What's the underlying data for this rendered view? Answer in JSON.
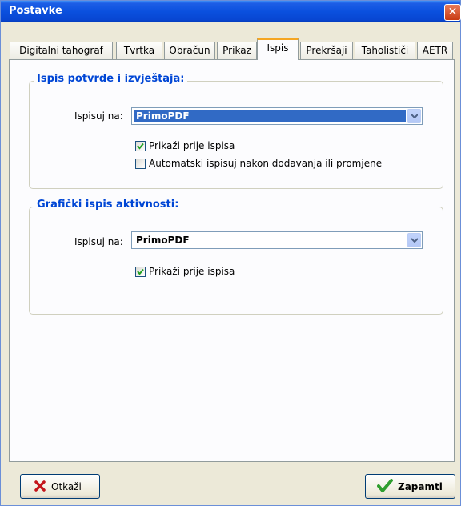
{
  "window": {
    "title": "Postavke",
    "close_glyph": "✕"
  },
  "tabs": [
    {
      "label": "Digitalni tahograf"
    },
    {
      "label": "Tvrtka"
    },
    {
      "label": "Obračun"
    },
    {
      "label": "Prikaz"
    },
    {
      "label": "Ispis"
    },
    {
      "label": "Prekršaji"
    },
    {
      "label": "Taholističi"
    },
    {
      "label": "AETR"
    }
  ],
  "active_tab": "Ispis",
  "group1": {
    "title": "Ispis potvrde i izvještaja:",
    "printer_label": "Ispisuj na:",
    "printer_value": "PrimoPDF",
    "preview_label": "Prikaži prije ispisa",
    "preview_checked": true,
    "auto_label": "Automatski ispisuj nakon dodavanja ili promjene",
    "auto_checked": false
  },
  "group2": {
    "title": "Grafički ispis aktivnosti:",
    "printer_label": "Ispisuj na:",
    "printer_value": "PrimoPDF",
    "preview_label": "Prikaži prije ispisa",
    "preview_checked": true
  },
  "buttons": {
    "cancel_label": "Otkaži",
    "save_label": "Zapamti"
  },
  "icons": {
    "cancel": "x-icon",
    "save": "checkmark-icon",
    "close": "close-icon",
    "dropdown": "chevron-down-icon"
  },
  "colors": {
    "titlebar": "#0a50de",
    "group_title": "#0046d5",
    "selection": "#316ac5",
    "active_tab_accent": "#f5a623"
  }
}
